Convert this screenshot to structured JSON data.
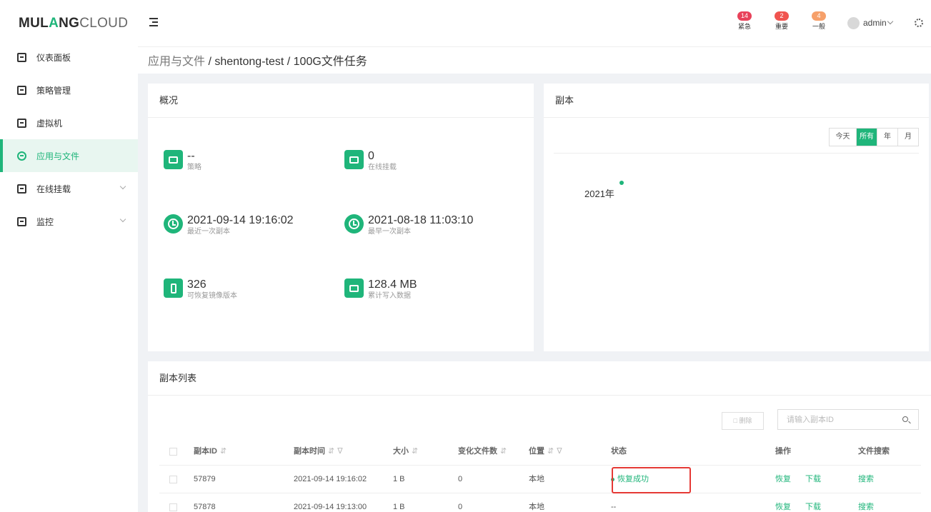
{
  "logo": {
    "part1": "MUL",
    "part2": "A",
    "part3": "NG",
    "part4": "CLOUD"
  },
  "sidebar": {
    "items": [
      {
        "label": "仪表面板"
      },
      {
        "label": "策略管理"
      },
      {
        "label": "虚拟机"
      },
      {
        "label": "应用与文件"
      },
      {
        "label": "在线挂载"
      },
      {
        "label": "监控"
      }
    ]
  },
  "header": {
    "alerts": [
      {
        "count": "14",
        "label": "紧急",
        "color": "#e8425a"
      },
      {
        "count": "2",
        "label": "重要",
        "color": "#f0544f"
      },
      {
        "count": "4",
        "label": "一般",
        "color": "#f6a06a"
      }
    ],
    "user": "admin"
  },
  "breadcrumb": {
    "part1": "应用与文件",
    "part2": " / shentong-test / 100G文件任务"
  },
  "overview": {
    "title": "概况",
    "stats": [
      {
        "value": "--",
        "label": "策略",
        "icon": "monitor-icon"
      },
      {
        "value": "0",
        "label": "在线挂载",
        "icon": "mount-icon"
      },
      {
        "value": "2021-09-14 19:16:02",
        "label": "最近一次副本",
        "icon": "clock-icon"
      },
      {
        "value": "2021-08-18 11:03:10",
        "label": "最早一次副本",
        "icon": "clock-icon"
      },
      {
        "value": "326",
        "label": "可恢复镜像版本",
        "icon": "version-icon"
      },
      {
        "value": "128.4 MB",
        "label": "累计写入数据",
        "icon": "inbox-icon"
      }
    ]
  },
  "replica": {
    "title": "副本",
    "filters": [
      "今天",
      "所有",
      "年",
      "月"
    ],
    "active_filter": "所有",
    "timeline_year": "2021年"
  },
  "replica_list": {
    "title": "副本列表",
    "delete_label": "删除",
    "search_placeholder": "请输入副本ID",
    "columns": {
      "id": "副本ID",
      "time": "副本时间",
      "size": "大小",
      "changed": "变化文件数",
      "location": "位置",
      "status": "状态",
      "actions": "操作",
      "file_search": "文件搜索"
    },
    "rows": [
      {
        "id": "57879",
        "time": "2021-09-14 19:16:02",
        "size": "1 B",
        "changed": "0",
        "location": "本地",
        "status": "恢复成功",
        "restore": "恢复",
        "download": "下载",
        "search": "搜索"
      },
      {
        "id": "57878",
        "time": "2021-09-14 19:13:00",
        "size": "1 B",
        "changed": "0",
        "location": "本地",
        "status": "--",
        "restore": "恢复",
        "download": "下载",
        "search": "搜索"
      }
    ]
  }
}
